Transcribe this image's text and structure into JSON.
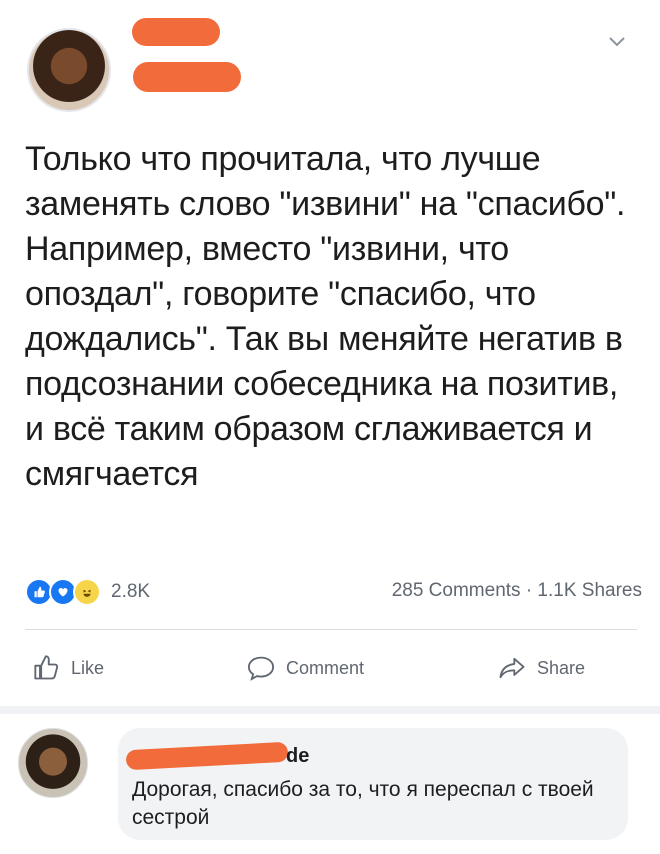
{
  "post": {
    "text": "Только что прочитала, что лучше заменять слово \"извини\" на \"спасибо\". Например, вместо \"извини, что опоздал\", говорите \"спасибо, что дождались\". Так вы меняйте негатив в подсознании собеседника на позитив, и всё таким образом сглаживается и смягчается",
    "reaction_count": "2.8K",
    "stats": "285 Comments · 1.1K Shares",
    "reactions": [
      "like-icon",
      "love-icon",
      "haha-icon"
    ]
  },
  "actions": {
    "like": "Like",
    "comment": "Comment",
    "share": "Share"
  },
  "comment": {
    "name_visible": "de",
    "text": "Дорогая, спасибо за то, что я переспал с твоей сестрой"
  },
  "colors": {
    "redaction": "#f26b3a",
    "facebook_blue": "#1877f2"
  }
}
